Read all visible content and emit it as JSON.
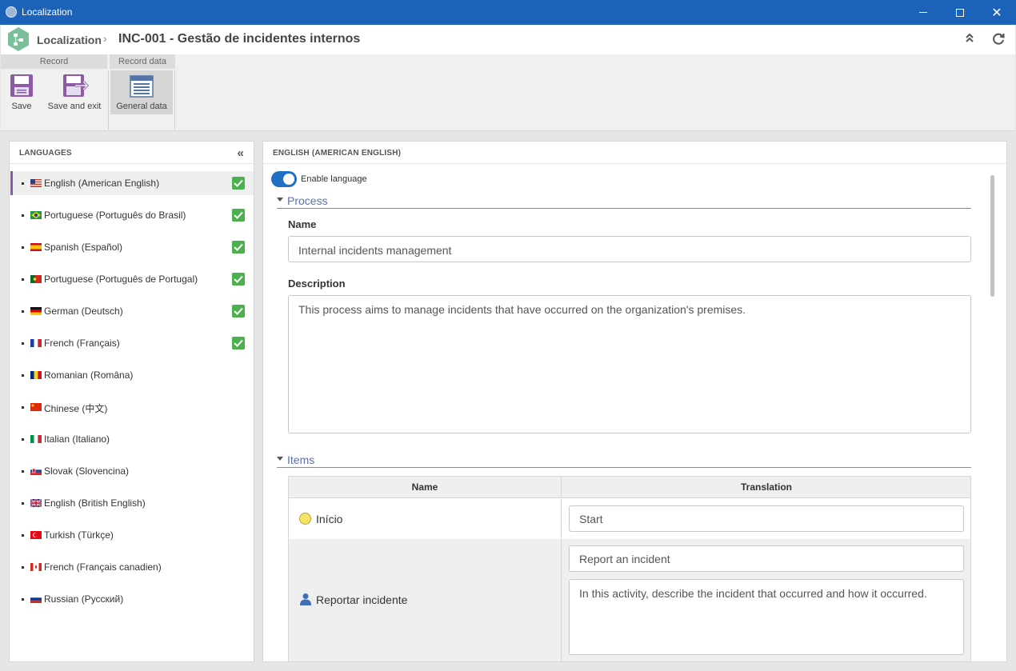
{
  "window": {
    "title": "Localization"
  },
  "header": {
    "breadcrumb": "Localization",
    "title": "INC-001 - Gestão de incidentes internos"
  },
  "toolbar": {
    "groups": [
      {
        "label": "Record"
      },
      {
        "label": "Record data"
      }
    ],
    "buttons": {
      "save": "Save",
      "save_exit": "Save and exit",
      "general_data": "General data"
    }
  },
  "languages": {
    "title": "LANGUAGES",
    "items": [
      {
        "label": "English (American English)",
        "flag": "us",
        "checked": true,
        "selected": true
      },
      {
        "label": "Portuguese (Português do Brasil)",
        "flag": "br",
        "checked": true
      },
      {
        "label": "Spanish (Español)",
        "flag": "es",
        "checked": true
      },
      {
        "label": "Portuguese (Português de Portugal)",
        "flag": "pt",
        "checked": true
      },
      {
        "label": "German (Deutsch)",
        "flag": "de",
        "checked": true
      },
      {
        "label": "French (Français)",
        "flag": "fr",
        "checked": true
      },
      {
        "label": "Romanian (Româna)",
        "flag": "ro",
        "checked": false
      },
      {
        "label": "Chinese (中文)",
        "flag": "cn",
        "checked": false
      },
      {
        "label": "Italian (Italiano)",
        "flag": "it",
        "checked": false
      },
      {
        "label": "Slovak (Slovencina)",
        "flag": "sk",
        "checked": false
      },
      {
        "label": "English (British English)",
        "flag": "gb",
        "checked": false
      },
      {
        "label": "Turkish (Türkçe)",
        "flag": "tr",
        "checked": false
      },
      {
        "label": "French (Français canadien)",
        "flag": "ca",
        "checked": false
      },
      {
        "label": "Russian (Русский)",
        "flag": "ru",
        "checked": false
      }
    ]
  },
  "main": {
    "title": "ENGLISH (AMERICAN ENGLISH)",
    "enable_label": "Enable language",
    "enabled": true,
    "process": {
      "section_title": "Process",
      "name_label": "Name",
      "name_value": "Internal incidents management",
      "description_label": "Description",
      "description_value": "This process aims to manage incidents that have occurred on the organization's premises."
    },
    "items": {
      "section_title": "Items",
      "columns": [
        "Name",
        "Translation"
      ],
      "rows": [
        {
          "name": "Início",
          "icon": "start-event-icon",
          "translation": "Start"
        },
        {
          "name": "Reportar incidente",
          "icon": "user-activity-icon",
          "translation": "Report an incident",
          "description": "In this activity, describe the incident that occurred and how it occurred."
        }
      ]
    }
  },
  "colors": {
    "titlebar": "#1c62b8",
    "accent": "#8e57a8",
    "toggle": "#1f6fc5",
    "check": "#4caf50",
    "section_title": "#5b6fb3"
  }
}
